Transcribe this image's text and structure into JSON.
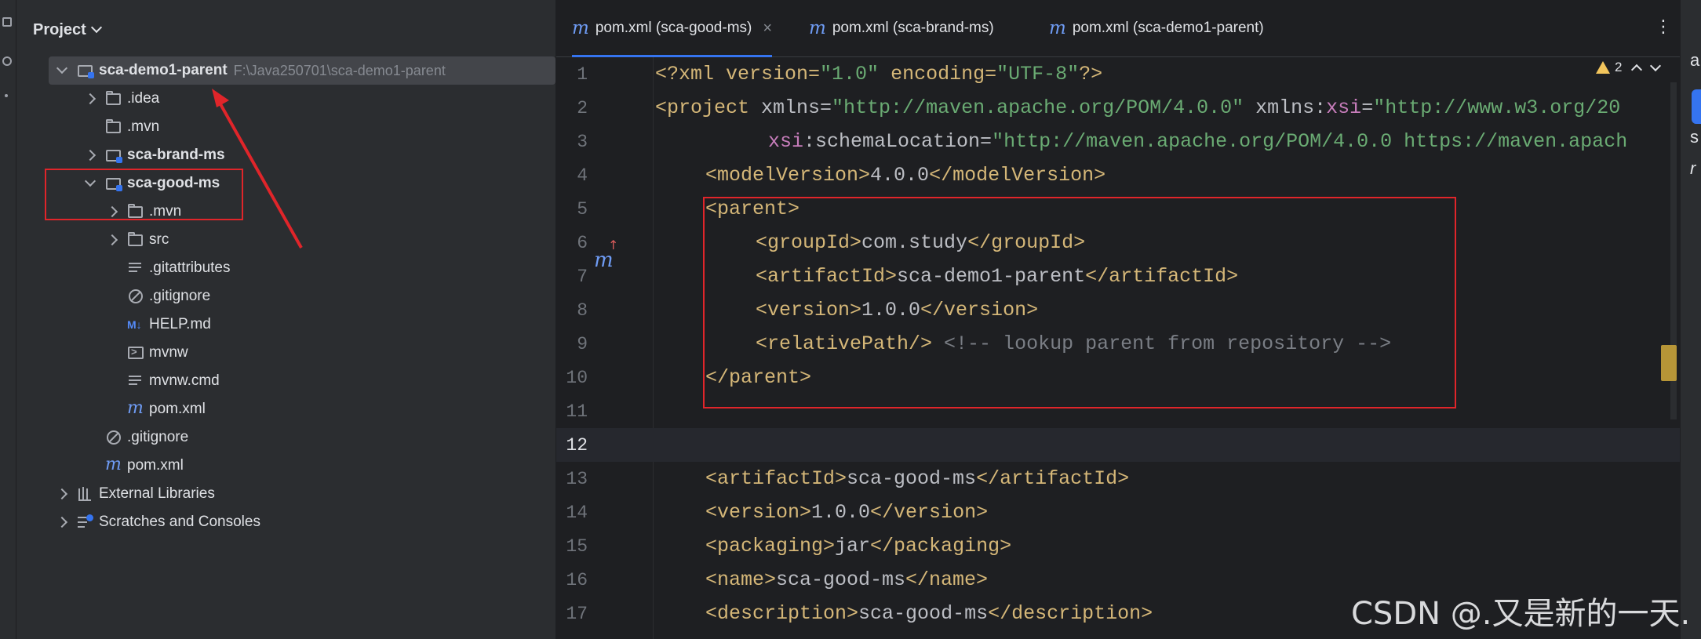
{
  "project_panel": {
    "title": "Project",
    "tree": [
      {
        "label": "sca-demo1-parent",
        "hint": "F:\\Java250701\\sca-demo1-parent"
      },
      {
        "label": ".idea"
      },
      {
        "label": ".mvn"
      },
      {
        "label": "sca-brand-ms"
      },
      {
        "label": "sca-good-ms"
      },
      {
        "label": ".mvn"
      },
      {
        "label": "src"
      },
      {
        "label": ".gitattributes"
      },
      {
        "label": ".gitignore"
      },
      {
        "label": "HELP.md"
      },
      {
        "label": "mvnw"
      },
      {
        "label": "mvnw.cmd"
      },
      {
        "label": "pom.xml"
      },
      {
        "label": ".gitignore"
      },
      {
        "label": "pom.xml"
      },
      {
        "label": "External Libraries"
      },
      {
        "label": "Scratches and Consoles"
      }
    ]
  },
  "editor": {
    "tabs": [
      {
        "label": "pom.xml (sca-good-ms)",
        "active": true
      },
      {
        "label": "pom.xml (sca-brand-ms)",
        "active": false
      },
      {
        "label": "pom.xml (sca-demo1-parent)",
        "active": false
      }
    ],
    "warning_count": "2",
    "current_line": 12,
    "lines": [
      {
        "n": "1"
      },
      {
        "n": "2"
      },
      {
        "n": "3"
      },
      {
        "n": "4"
      },
      {
        "n": "5"
      },
      {
        "n": "6"
      },
      {
        "n": "7"
      },
      {
        "n": "8"
      },
      {
        "n": "9"
      },
      {
        "n": "10"
      },
      {
        "n": "11"
      },
      {
        "n": "12"
      },
      {
        "n": "13"
      },
      {
        "n": "14"
      },
      {
        "n": "15"
      },
      {
        "n": "16"
      },
      {
        "n": "17"
      }
    ],
    "code": {
      "l1": [
        "<?xml version=",
        "\"1.0\"",
        " encoding=",
        "\"UTF-8\"",
        "?>"
      ],
      "l2": [
        "<project ",
        "xmlns=",
        "\"http://maven.apache.org/POM/4.0.0\"",
        " xmlns:",
        "xsi",
        "=",
        "\"http://www.w3.org/20"
      ],
      "l3": [
        "xsi",
        ":schemaLocation=",
        "\"http://maven.apache.org/POM/4.0.0 https://maven.apach"
      ],
      "l4": [
        "<modelVersion>",
        "4.0.0",
        "</modelVersion>"
      ],
      "l5": [
        "<parent>"
      ],
      "l6": [
        "<groupId>",
        "com.study",
        "</groupId>"
      ],
      "l7": [
        "<artifactId>",
        "sca-demo1-parent",
        "</artifactId>"
      ],
      "l8": [
        "<version>",
        "1.0.0",
        "</version>"
      ],
      "l9": [
        "<relativePath/>",
        " <!-- lookup parent from repository -->"
      ],
      "l10": [
        "</parent>"
      ],
      "l13": [
        "<artifactId>",
        "sca-good-ms",
        "</artifactId>"
      ],
      "l14": [
        "<version>",
        "1.0.0",
        "</version>"
      ],
      "l15": [
        "<packaging>",
        "jar",
        "</packaging>"
      ],
      "l16": [
        "<name>",
        "sca-good-ms",
        "</name>"
      ],
      "l17": [
        "<description>",
        "sca-good-ms",
        "</description>"
      ]
    }
  },
  "right_strip": {
    "glyphs": [
      "a",
      "s",
      "r"
    ]
  },
  "watermark": "CSDN @.又是新的一天.",
  "colors": {
    "annotation_red": "#e0252a",
    "accent": "#3574f0",
    "xml_tag": "#d5b778",
    "xml_string": "#6aab73"
  }
}
